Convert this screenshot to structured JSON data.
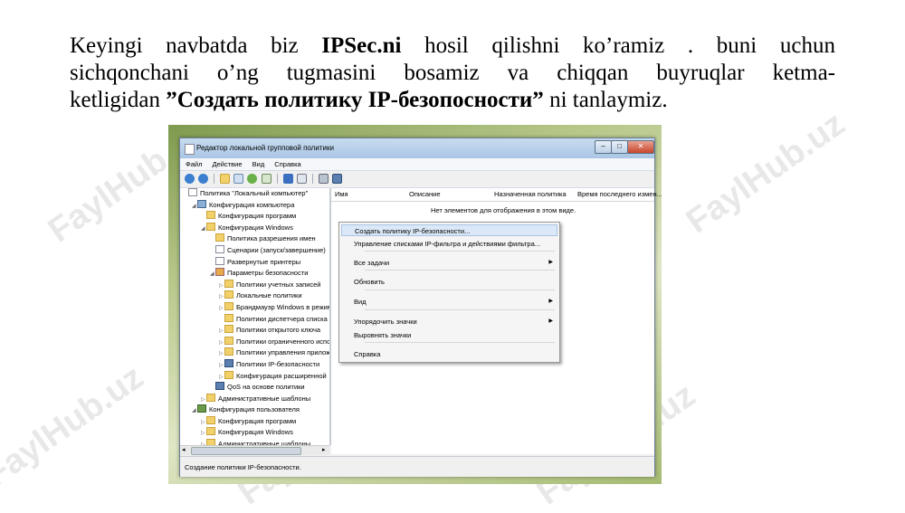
{
  "slide": {
    "line1": {
      "a": "Keyingi navbatda biz ",
      "b": "IPSec.ni",
      "c": " hosil qilishni ko’ramiz . buni uchun"
    },
    "line2": "sichqonchani o’ng tugmasini bosamiz va chiqqan buyruqlar ketma-",
    "line3": {
      "a": "ketligidan ",
      "b": "”Создать политику  IP-безопосности”",
      "c": " ni tanlaymiz."
    }
  },
  "watermark": "FaylHub.uz",
  "window": {
    "title": "Редактор локальной групповой политики",
    "buttons": {
      "minimize": "–",
      "maximize": "□",
      "close": "✕"
    },
    "menu": [
      "Файл",
      "Действие",
      "Вид",
      "Справка"
    ],
    "toolbar_icons": [
      "back-arrow-icon",
      "forward-arrow-icon",
      "up-folder-icon",
      "show-tree-icon",
      "refresh-icon",
      "export-icon",
      "help-icon",
      "properties-icon",
      "security-icon",
      "ipsec-icon"
    ],
    "tree": [
      {
        "label": "Политика \"Локальный компьютер\"",
        "icon": "doc",
        "indent": 0,
        "exp": ""
      },
      {
        "label": "Конфигурация компьютера",
        "icon": "pc",
        "indent": 1,
        "exp": "◢"
      },
      {
        "label": "Конфигурация программ",
        "icon": "folder",
        "indent": 2,
        "exp": ""
      },
      {
        "label": "Конфигурация Windows",
        "icon": "folder",
        "indent": 2,
        "exp": "◢"
      },
      {
        "label": "Политика разрешения имен",
        "icon": "folder",
        "indent": 3,
        "exp": ""
      },
      {
        "label": "Сценарии (запуск/завершение)",
        "icon": "doc",
        "indent": 3,
        "exp": ""
      },
      {
        "label": "Развернутые принтеры",
        "icon": "doc",
        "indent": 3,
        "exp": ""
      },
      {
        "label": "Параметры безопасности",
        "icon": "shield",
        "indent": 3,
        "exp": "◢"
      },
      {
        "label": "Политики учетных записей",
        "icon": "folder",
        "indent": 4,
        "exp": "▷"
      },
      {
        "label": "Локальные политики",
        "icon": "folder",
        "indent": 4,
        "exp": "▷"
      },
      {
        "label": "Брандмауэр Windows в режиме",
        "icon": "folder",
        "indent": 4,
        "exp": "▷"
      },
      {
        "label": "Политики диспетчера списка сетей",
        "icon": "folder",
        "indent": 4,
        "exp": ""
      },
      {
        "label": "Политики открытого ключа",
        "icon": "folder",
        "indent": 4,
        "exp": "▷"
      },
      {
        "label": "Политики ограниченного использования",
        "icon": "folder",
        "indent": 4,
        "exp": "▷"
      },
      {
        "label": "Политики управления приложениями",
        "icon": "folder",
        "indent": 4,
        "exp": "▷"
      },
      {
        "label": "Политики IP-безопасности",
        "icon": "net",
        "indent": 4,
        "exp": "▷"
      },
      {
        "label": "Конфигурация расширенной",
        "icon": "folder",
        "indent": 4,
        "exp": "▷"
      },
      {
        "label": "QoS на основе политики",
        "icon": "net",
        "indent": 3,
        "exp": ""
      },
      {
        "label": "Административные шаблоны",
        "icon": "folder",
        "indent": 2,
        "exp": "▷"
      },
      {
        "label": "Конфигурация пользователя",
        "icon": "user",
        "indent": 1,
        "exp": "◢"
      },
      {
        "label": "Конфигурация программ",
        "icon": "folder",
        "indent": 2,
        "exp": "▷"
      },
      {
        "label": "Конфигурация Windows",
        "icon": "folder",
        "indent": 2,
        "exp": "▷"
      },
      {
        "label": "Административные шаблоны",
        "icon": "folder",
        "indent": 2,
        "exp": "▷"
      }
    ],
    "columns": [
      "Имя",
      "Описание",
      "Назначенная политика",
      "Время последнего измен..."
    ],
    "empty_text": "Нет элементов для отображения в этом виде.",
    "context_menu": [
      {
        "label": "Создать политику IP-безопасности...",
        "highlight": true,
        "submenu": false
      },
      {
        "label": "Управление списками IP-фильтра и действиями фильтра...",
        "highlight": false,
        "submenu": false
      },
      {
        "sep": true
      },
      {
        "label": "Все задачи",
        "highlight": false,
        "submenu": true
      },
      {
        "sep": true
      },
      {
        "label": "Обновить",
        "highlight": false,
        "submenu": false
      },
      {
        "sep": true
      },
      {
        "label": "Вид",
        "highlight": false,
        "submenu": true
      },
      {
        "sep": true
      },
      {
        "label": "Упорядочить значки",
        "highlight": false,
        "submenu": true
      },
      {
        "label": "Выровнять значки",
        "highlight": false,
        "submenu": false
      },
      {
        "sep": true
      },
      {
        "label": "Справка",
        "highlight": false,
        "submenu": false
      }
    ],
    "status_text": "Создание политики IP-безопасности."
  }
}
